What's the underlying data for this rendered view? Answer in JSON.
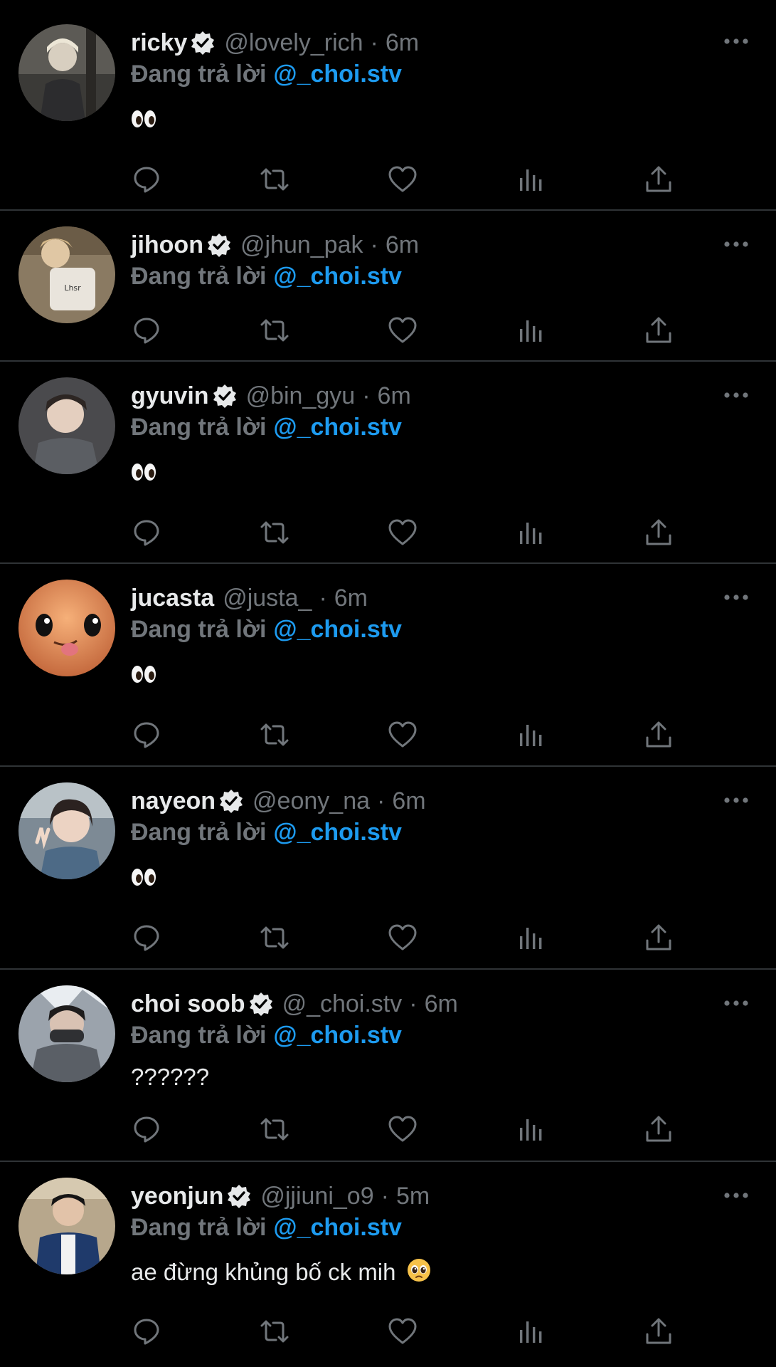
{
  "colors": {
    "background": "#000000",
    "text": "#e7e9ea",
    "muted": "#71767b",
    "accent": "#1d9bf0",
    "divider": "#2f3336"
  },
  "icons": {
    "reply": "reply-icon",
    "retweet": "retweet-icon",
    "like": "heart-icon",
    "views": "views-icon",
    "share": "share-icon",
    "more": "more-icon",
    "verified": "verified-badge-icon"
  },
  "tweets": [
    {
      "display_name": "ricky",
      "verified": true,
      "handle": "@lovely_rich",
      "separator": "·",
      "time": "6m",
      "reply_prefix": "Đang trả lời",
      "reply_to": "@_choi.stv",
      "content": "",
      "content_emoji": "eyes"
    },
    {
      "display_name": "jihoon",
      "verified": true,
      "handle": "@jhun_pak",
      "separator": "·",
      "time": "6m",
      "reply_prefix": "Đang trả lời",
      "reply_to": "@_choi.stv",
      "content": "",
      "content_emoji": ""
    },
    {
      "display_name": "gyuvin",
      "verified": true,
      "handle": "@bin_gyu",
      "separator": "·",
      "time": "6m",
      "reply_prefix": "Đang trả lời",
      "reply_to": "@_choi.stv",
      "content": "",
      "content_emoji": "eyes"
    },
    {
      "display_name": "jucasta",
      "verified": false,
      "handle": "@justa_",
      "separator": "·",
      "time": "6m",
      "reply_prefix": "Đang trả lời",
      "reply_to": "@_choi.stv",
      "content": "",
      "content_emoji": "eyes"
    },
    {
      "display_name": "nayeon",
      "verified": true,
      "handle": "@eony_na",
      "separator": "·",
      "time": "6m",
      "reply_prefix": "Đang trả lời",
      "reply_to": "@_choi.stv",
      "content": "",
      "content_emoji": "eyes"
    },
    {
      "display_name": "choi soob",
      "verified": true,
      "handle": "@_choi.stv",
      "separator": "·",
      "time": "6m",
      "reply_prefix": "Đang trả lời",
      "reply_to": "@_choi.stv",
      "content": "??????",
      "content_emoji": ""
    },
    {
      "display_name": "yeonjun",
      "verified": true,
      "handle": "@jjiuni_o9",
      "separator": "·",
      "time": "5m",
      "reply_prefix": "Đang trả lời",
      "reply_to": "@_choi.stv",
      "content": "ae đừng khủng bố ck mih",
      "content_emoji": "pleading-face"
    }
  ]
}
